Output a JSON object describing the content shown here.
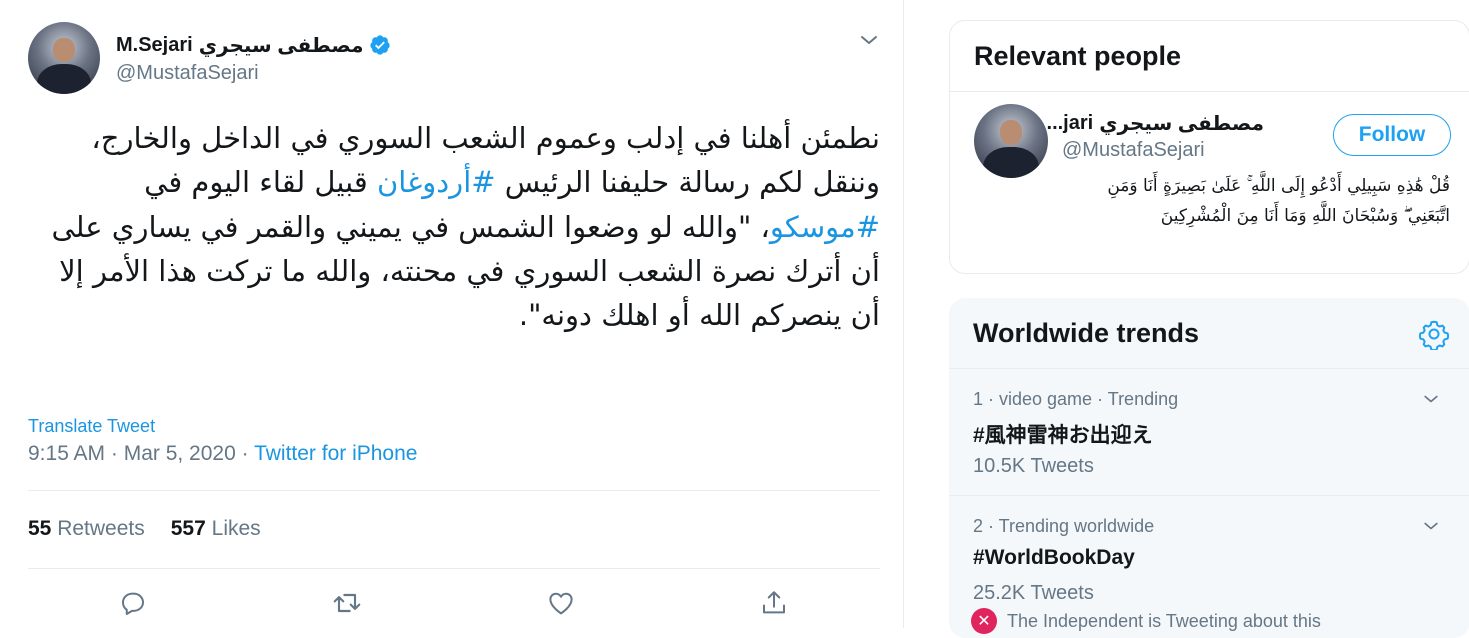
{
  "colors": {
    "accent": "#1da1f2",
    "link": "#1b95e0",
    "muted": "#657786",
    "text": "#14171a",
    "divider": "#e6ecf0",
    "sidebar_bg": "#f5f8fa"
  },
  "tweet": {
    "author_name_arabic": "مصطفى سيجري",
    "author_name_latin": "M.Sejari",
    "author_handle": "@MustafaSejari",
    "text_part1": "نطمئن أهلنا في إدلب وعموم الشعب السوري في الداخل والخارج، وننقل لكم رسالة حليفنا الرئيس ",
    "hashtag1": "#أردوغان",
    "text_part2": " قبيل لقاء اليوم في ",
    "hashtag2": "#موسكو",
    "text_part3": "، \"والله لو وضعوا الشمس في يميني والقمر في يساري على أن أترك نصرة الشعب السوري في محنته، والله ما تركت هذا الأمر إلا أن ينصركم الله أو اهلك دونه\".",
    "translate_label": "Translate Tweet",
    "timestamp": "9:15 AM · Mar 5, 2020 · ",
    "source": "Twitter for iPhone",
    "retweets_count": "55",
    "retweets_label": "Retweets",
    "likes_count": "557",
    "likes_label": "Likes"
  },
  "icons": {
    "verified": "verified-badge-icon",
    "menu": "chevron-down-icon",
    "reply": "reply-icon",
    "retweet": "retweet-icon",
    "like": "heart-icon",
    "share": "share-icon",
    "settings": "gear-icon"
  },
  "relevant_people": {
    "title": "Relevant people",
    "person": {
      "name_display": "مصطفى سيجري M.Se...",
      "name_arabic": "مصطفى سيجري",
      "name_suffix": "...jari",
      "handle": "@MustafaSejari",
      "follow_label": "Follow",
      "bio": "قُلْ هَٰذِهِ سَبِيلِي أَدْعُو إِلَى اللَّهِ ۚ عَلَىٰ بَصِيرَةٍ أَنَا وَمَنِ اتَّبَعَنِي ۖ وَسُبْحَانَ اللَّهِ وَمَا أَنَا مِنَ الْمُشْرِكِينَ"
    }
  },
  "trends": {
    "title": "Worldwide trends",
    "items": [
      {
        "meta": "1 · video game · Trending",
        "name": "#風神雷神お出迎え",
        "count": "10.5K Tweets"
      },
      {
        "meta": "2 · Trending worldwide",
        "name": "#WorldBookDay",
        "count": "25.2K Tweets"
      }
    ],
    "note": "The Independent is Tweeting about this"
  }
}
